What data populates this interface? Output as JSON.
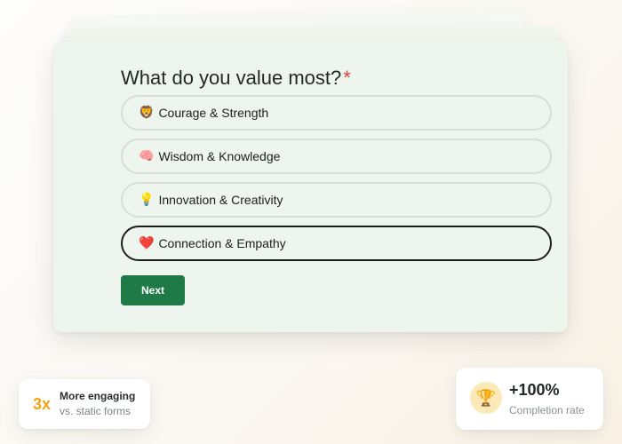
{
  "form": {
    "question": "What do you value most?",
    "required_marker": "*",
    "options": [
      {
        "emoji": "🦁",
        "label": "Courage & Strength",
        "selected": false
      },
      {
        "emoji": "🧠",
        "label": "Wisdom & Knowledge",
        "selected": false
      },
      {
        "emoji": "💡",
        "label": "Innovation & Creativity",
        "selected": false
      },
      {
        "emoji": "❤️",
        "label": "Connection & Empathy",
        "selected": true
      }
    ],
    "next_label": "Next"
  },
  "stats": {
    "engaging": {
      "value": "3x",
      "title": "More engaging",
      "subtitle": "vs. static forms"
    },
    "completion": {
      "icon": "trophy-icon",
      "value": "+100%",
      "subtitle": "Completion rate"
    }
  },
  "colors": {
    "accent_green": "#1f7a47",
    "required_red": "#e0433b",
    "highlight_orange": "#f2a516",
    "trophy_bg": "#fbeab8"
  }
}
